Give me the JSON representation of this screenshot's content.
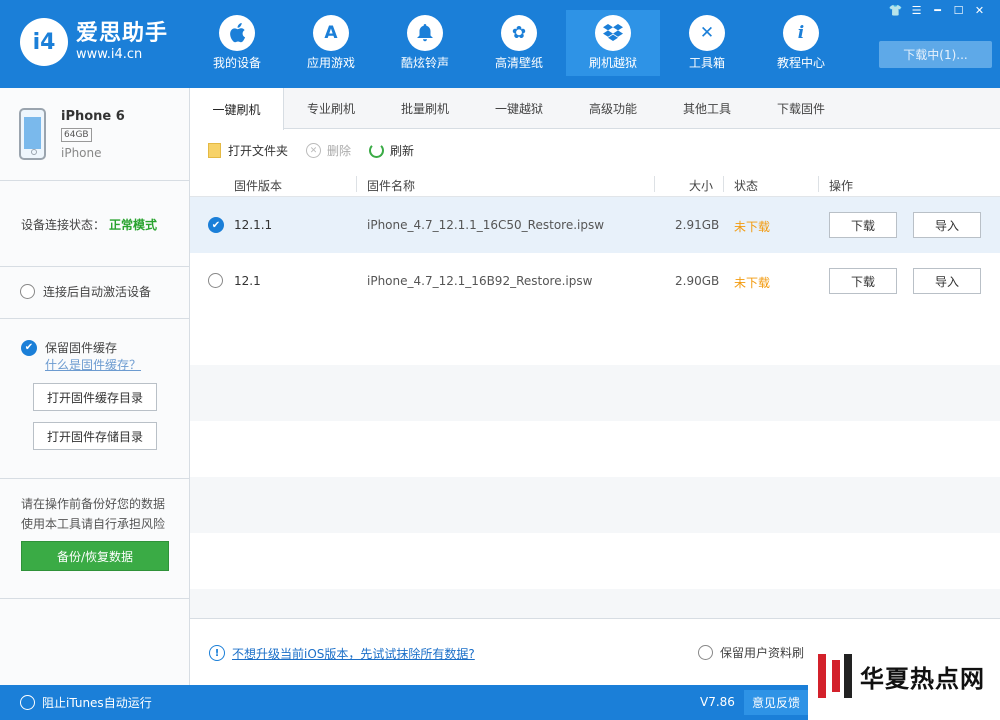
{
  "app": {
    "logo_mark": "i4",
    "title": "爱思助手",
    "url": "www.i4.cn"
  },
  "nav": [
    {
      "label": "我的设备",
      "icon": "apple-icon",
      "glyph": ""
    },
    {
      "label": "应用游戏",
      "icon": "app-store-icon",
      "glyph": "A"
    },
    {
      "label": "酷炫铃声",
      "icon": "bell-icon",
      "glyph": "♪"
    },
    {
      "label": "高清壁纸",
      "icon": "flower-icon",
      "glyph": "✿"
    },
    {
      "label": "刷机越狱",
      "icon": "box-icon",
      "glyph": "❒"
    },
    {
      "label": "工具箱",
      "icon": "tools-icon",
      "glyph": "✕"
    },
    {
      "label": "教程中心",
      "icon": "info-icon",
      "glyph": "i"
    }
  ],
  "window": {
    "download_status": "下载中(1)..."
  },
  "device": {
    "name": "iPhone 6",
    "capacity": "64GB",
    "type": "iPhone"
  },
  "sidebar": {
    "status_label": "设备连接状态：",
    "status_value": "正常模式",
    "auto_activate": "连接后自动激活设备",
    "keep_cache": "保留固件缓存",
    "cache_link": "什么是固件缓存？",
    "open_cache_dir": "打开固件缓存目录",
    "open_store_dir": "打开固件存储目录",
    "warning_line1": "请在操作前备份好您的数据",
    "warning_line2": "使用本工具请自行承担风险",
    "backup_btn": "备份/恢复数据"
  },
  "tabs": [
    "一键刷机",
    "专业刷机",
    "批量刷机",
    "一键越狱",
    "高级功能",
    "其他工具",
    "下载固件"
  ],
  "toolbar": {
    "open_folder": "打开文件夹",
    "delete": "删除",
    "refresh": "刷新"
  },
  "table": {
    "headers": {
      "version": "固件版本",
      "name": "固件名称",
      "size": "大小",
      "status": "状态",
      "action": "操作"
    },
    "rows": [
      {
        "version": "12.1.1",
        "name": "iPhone_4.7_12.1.1_16C50_Restore.ipsw",
        "size": "2.91GB",
        "status": "未下载",
        "download": "下载",
        "import": "导入",
        "selected": true
      },
      {
        "version": "12.1",
        "name": "iPhone_4.7_12.1_16B92_Restore.ipsw",
        "size": "2.90GB",
        "status": "未下载",
        "download": "下载",
        "import": "导入",
        "selected": false
      }
    ]
  },
  "bottom": {
    "erase_link": "不想升级当前iOS版本，先试试抹除所有数据?",
    "keep_user_data": "保留用户资料刷"
  },
  "footer": {
    "itunes": "阻止iTunes自动运行",
    "version": "V7.86",
    "feedback": "意见反馈"
  },
  "watermark": {
    "text": "华夏热点网"
  },
  "colors": {
    "brand": "#1b7fd8",
    "ok_green": "#29a32e",
    "warn_orange": "#f29a0e"
  }
}
